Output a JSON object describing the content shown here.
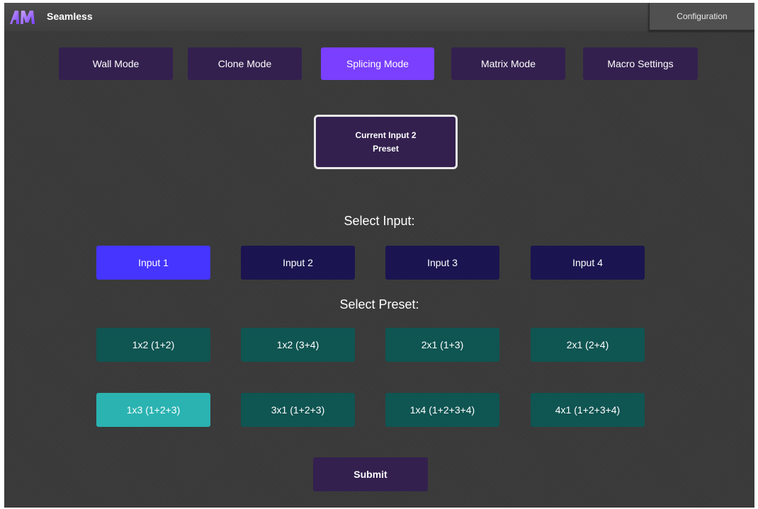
{
  "header": {
    "app_title": "Seamless",
    "config_label": "Configuration"
  },
  "modes": [
    {
      "label": "Wall Mode",
      "active": false
    },
    {
      "label": "Clone Mode",
      "active": false
    },
    {
      "label": "Splicing Mode",
      "active": true
    },
    {
      "label": "Matrix Mode",
      "active": false
    },
    {
      "label": "Macro Settings",
      "active": false
    }
  ],
  "current": {
    "line1": "Current Input 2",
    "line2": "Preset"
  },
  "select_input_label": "Select Input:",
  "inputs": [
    {
      "label": "Input 1",
      "active": true
    },
    {
      "label": "Input 2",
      "active": false
    },
    {
      "label": "Input 3",
      "active": false
    },
    {
      "label": "Input 4",
      "active": false
    }
  ],
  "select_preset_label": "Select Preset:",
  "presets": [
    {
      "label": "1x2 (1+2)",
      "active": false
    },
    {
      "label": "1x2 (3+4)",
      "active": false
    },
    {
      "label": "2x1 (1+3)",
      "active": false
    },
    {
      "label": "2x1 (2+4)",
      "active": false
    },
    {
      "label": "1x3 (1+2+3)",
      "active": true
    },
    {
      "label": "3x1 (1+2+3)",
      "active": false
    },
    {
      "label": "1x4 (1+2+3+4)",
      "active": false
    },
    {
      "label": "4x1 (1+2+3+4)",
      "active": false
    }
  ],
  "submit_label": "Submit",
  "colors": {
    "background": "#3a3a3a",
    "mode_button": "#33204f",
    "mode_active": "#7a3fff",
    "input_button": "#1a1550",
    "input_active": "#4535ff",
    "preset_button": "#0f5552",
    "preset_active": "#2bb3b1"
  },
  "icons": {
    "logo": "am-logo"
  }
}
